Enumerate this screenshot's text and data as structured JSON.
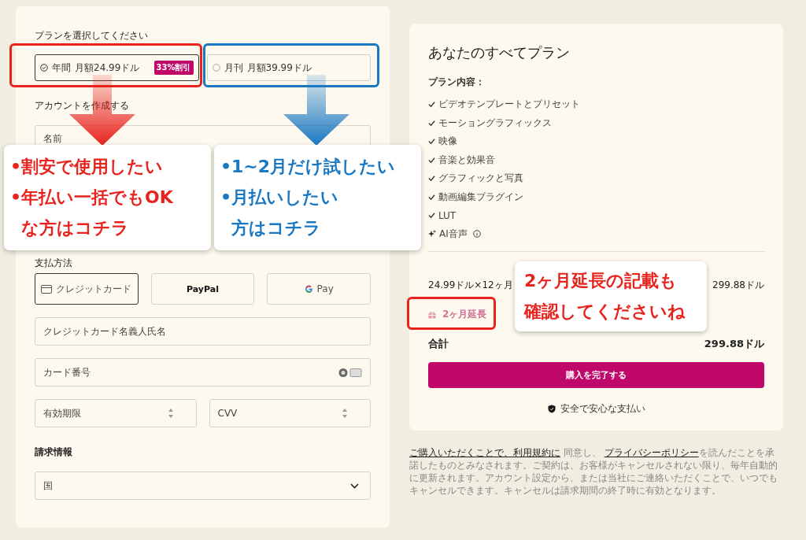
{
  "plan_section": {
    "title": "プランを選択してください",
    "options": [
      {
        "label": "年間",
        "price": "月額24.99ドル",
        "badge": "33%割引",
        "selected": true
      },
      {
        "label": "月刊",
        "price": "月額39.99ドル",
        "selected": false
      }
    ]
  },
  "account": {
    "title": "アカウントを作成する",
    "name_field": {
      "placeholder": "名前"
    }
  },
  "payment": {
    "title": "支払方法",
    "methods": [
      {
        "kind": "card",
        "label": "クレジットカード",
        "selected": true
      },
      {
        "kind": "paypal",
        "label": "PayPal",
        "selected": false
      },
      {
        "kind": "gpay",
        "label": "Pay",
        "selected": false
      }
    ],
    "fields": [
      {
        "kind": "text",
        "placeholder": "クレジットカード名義人氏名"
      },
      {
        "kind": "card",
        "placeholder": "カード番号"
      }
    ],
    "split_fields": [
      {
        "placeholder": "有効期限"
      },
      {
        "placeholder": "CVV"
      }
    ]
  },
  "billing": {
    "title": "請求情報",
    "country": {
      "placeholder": "国"
    }
  },
  "summary": {
    "title": "あなたのすべてプラン",
    "contents_label": "プラン内容：",
    "features": [
      {
        "kind": "check",
        "label": "ビデオテンプレートとプリセット"
      },
      {
        "kind": "check",
        "label": "モーショングラフィックス"
      },
      {
        "kind": "check",
        "label": "映像"
      },
      {
        "kind": "check",
        "label": "音楽と効果音"
      },
      {
        "kind": "check",
        "label": "グラフィックと写真"
      },
      {
        "kind": "check",
        "label": "動画編集プラグイン"
      },
      {
        "kind": "check",
        "label": "LUT"
      },
      {
        "kind": "ai",
        "label": "AI音声",
        "info": true
      }
    ],
    "line": {
      "label": "24.99ドル×12ヶ月",
      "amount": "299.88ドル"
    },
    "bonus": "2ヶ月延長",
    "total": {
      "label": "合計",
      "amount": "299.88ドル"
    },
    "button": "購入を完了する",
    "secure": "安全で安心な支払い"
  },
  "terms": [
    {
      "text": "ご購入いただくことで、利用規約に",
      "link": true
    },
    {
      "text": " 同意し、 ",
      "link": false
    },
    {
      "text": "プライバシーポリシー",
      "link": true
    },
    {
      "text": "を読んだことを承諾したものとみなされます。ご契約は、お客様がキャンセルされない限り、毎年自動的に更新されます。アカウント設定から、または当社にご連絡いただくことで、いつでもキャンセルできます。キャンセルは請求期間の終了時に有効となります。",
      "link": false
    }
  ],
  "annotations": {
    "callouts": [
      {
        "color": "#e8231e",
        "lines": [
          "•割安で使用したい",
          "•年払い一括でもOK",
          "な方はコチラ"
        ]
      },
      {
        "color": "#1a78c2",
        "lines": [
          "•1~2月だけ試したい",
          "•月払いしたい",
          "方はコチラ"
        ]
      }
    ],
    "note": {
      "color": "#e8231e",
      "lines": [
        "2ヶ月延長の記載も",
        "確認してくださいね"
      ]
    }
  }
}
